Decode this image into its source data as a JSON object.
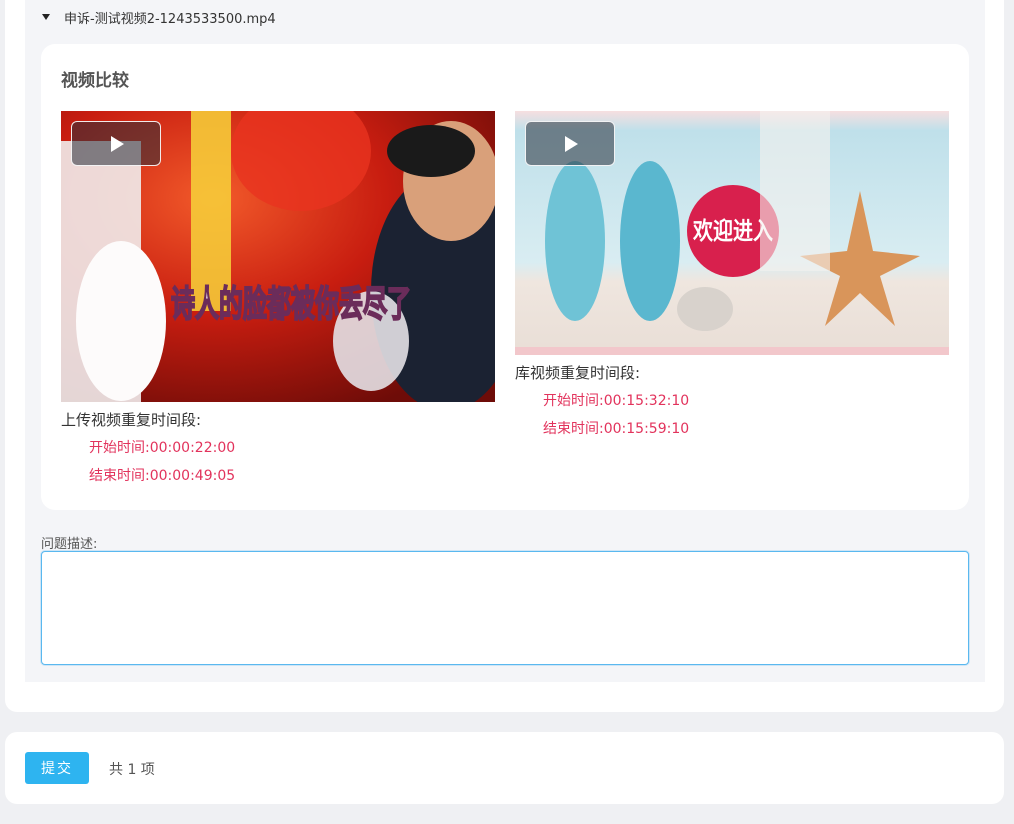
{
  "file": {
    "name": "申诉-测试视频2-1243533500.mp4",
    "expanded": true
  },
  "comparison": {
    "title": "视频比较",
    "upload": {
      "segment_title": "上传视频重复时间段:",
      "start_label": "开始时间:",
      "start_time": "00:00:22:00",
      "end_label": "结束时间:",
      "end_time": "00:00:49:05",
      "caption_text": "诗人的脸都被你丢尽了"
    },
    "library": {
      "segment_title": "库视频重复时间段:",
      "start_label": "开始时间:",
      "start_time": "00:15:32:10",
      "end_label": "结束时间:",
      "end_time": "00:15:59:10",
      "caption_text": "欢迎进入"
    }
  },
  "description": {
    "label": "问题描述:",
    "value": ""
  },
  "footer": {
    "submit_label": "提交",
    "total_text": "共 1 项"
  },
  "colors": {
    "accent": "#2eb4f0",
    "time_text": "#e2335c"
  }
}
